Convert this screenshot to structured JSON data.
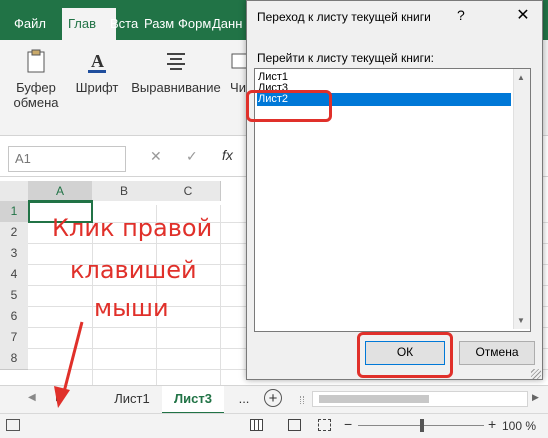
{
  "ribbon_tabs": [
    "Файл",
    "Глав",
    "Вста",
    "Разм",
    "Форм",
    "Данн"
  ],
  "ribbon_groups": [
    {
      "label_line1": "Буфер",
      "label_line2": "обмена",
      "icon": "clipboard-icon"
    },
    {
      "label_line1": "Шрифт",
      "label_line2": "",
      "icon": "font-icon"
    },
    {
      "label_line1": "Выравнивание",
      "label_line2": "",
      "icon": "align-icon"
    },
    {
      "label_line1": "Чи",
      "label_line2": "",
      "icon": "number-icon"
    }
  ],
  "namebox": "A1",
  "formula_icons": {
    "cancel": "✕",
    "enter": "✓",
    "fx": "fx"
  },
  "columns": [
    "A",
    "B",
    "C"
  ],
  "rows": [
    "1",
    "2",
    "3",
    "4",
    "5",
    "6",
    "7",
    "8"
  ],
  "sheet_tabs": [
    "Лист1",
    "Лист3"
  ],
  "sheetbar": {
    "more": "...",
    "add": "+"
  },
  "annotation": {
    "line1": "Клик правой",
    "line2": "клавишей",
    "line3": "мыши"
  },
  "zoom": "100 %",
  "dialog": {
    "title": "Переход к листу текущей книги",
    "help": "?",
    "close": "✕",
    "label": "Перейти к листу текущей книги:",
    "items": [
      "Лист1",
      "Лист3",
      "Лист2"
    ],
    "selected_index": 2,
    "ok": "ОК",
    "cancel": "Отмена"
  },
  "colors": {
    "excel_green": "#217346",
    "selection_blue": "#0078d7",
    "annotation_red": "#e0302a"
  }
}
